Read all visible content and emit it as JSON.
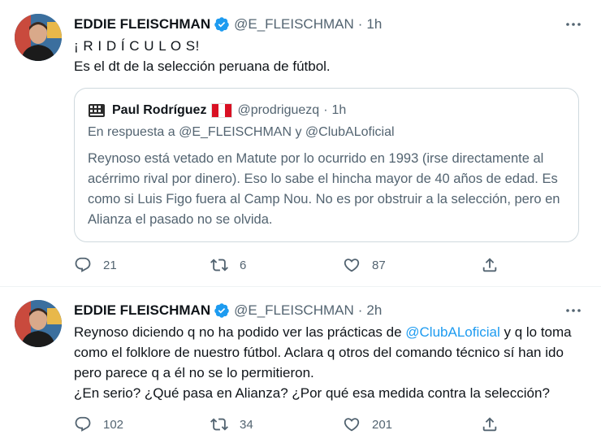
{
  "tweets": [
    {
      "author_name": "EDDIE FLEISCHMAN",
      "handle": "@E_FLEISCHMAN",
      "separator": "·",
      "time": "1h",
      "text_lines": [
        "¡ R I D Í C U L O S!",
        "Es el dt de la selección peruana de fútbol."
      ],
      "quote": {
        "author_name": "Paul Rodríguez",
        "handle": "@prodriguezq",
        "separator": "·",
        "time": "1h",
        "reply_to": "En respuesta a @E_FLEISCHMAN y @ClubALoficial",
        "text": "Reynoso está vetado en Matute por lo ocurrido en 1993 (irse directamente al acérrimo rival por dinero). Eso lo sabe el hincha mayor de 40 años de edad. Es como si Luis Figo fuera al Camp Nou. No es por obstruir a la selección, pero en Alianza el pasado no se olvida."
      },
      "actions": {
        "replies": "21",
        "retweets": "6",
        "likes": "87"
      }
    },
    {
      "author_name": "EDDIE FLEISCHMAN",
      "handle": "@E_FLEISCHMAN",
      "separator": "·",
      "time": "2h",
      "text_before_mention": "Reynoso diciendo q no ha podido ver las prácticas de ",
      "mention": "@ClubALoficial",
      "text_after_mention": " y q lo toma como el folklore de nuestro fútbol. Aclara q otros del comando técnico sí han ido pero parece q a él no se lo permitieron.",
      "text_line2": "¿En serio? ¿Qué pasa en Alianza? ¿Por qué esa medida contra la selección?",
      "actions": {
        "replies": "102",
        "retweets": "34",
        "likes": "201"
      }
    }
  ],
  "colors": {
    "link": "#1d9bf0",
    "secondary_text": "#536471",
    "verified": "#1d9bf0",
    "border": "#cfd9de"
  },
  "icons": [
    "more-icon",
    "verified-icon",
    "reply-icon",
    "retweet-icon",
    "like-icon",
    "share-icon",
    "peru-flag-icon"
  ]
}
